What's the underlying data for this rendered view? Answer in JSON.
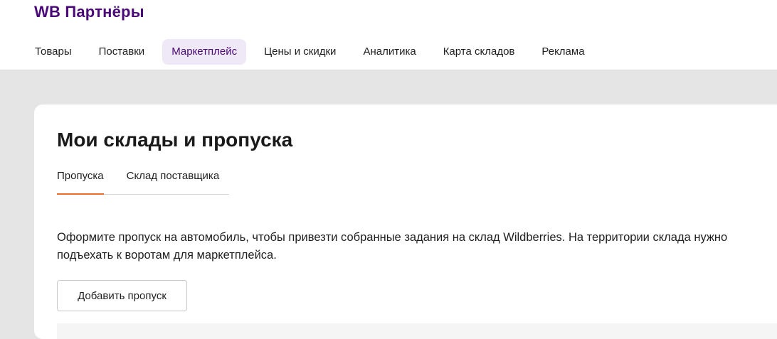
{
  "header": {
    "logo": "WB Партнёры",
    "nav": [
      {
        "label": "Товары",
        "active": false
      },
      {
        "label": "Поставки",
        "active": false
      },
      {
        "label": "Маркетплейс",
        "active": true
      },
      {
        "label": "Цены и скидки",
        "active": false
      },
      {
        "label": "Аналитика",
        "active": false
      },
      {
        "label": "Карта складов",
        "active": false
      },
      {
        "label": "Реклама",
        "active": false
      }
    ]
  },
  "main": {
    "title": "Мои склады и пропуска",
    "tabs": [
      {
        "label": "Пропуска",
        "active": true
      },
      {
        "label": "Склад поставщика",
        "active": false
      }
    ],
    "description": "Оформите пропуск на автомобиль, чтобы привезти собранные задания на склад Wildberries. На территории склада нужно подъехать к воротам для маркетплейса.",
    "add_button_label": "Добавить пропуск"
  },
  "colors": {
    "brand": "#4b0a7a",
    "active_nav_bg": "#efe8f6",
    "tab_underline": "#f06b28",
    "page_bg": "#e5e5e5"
  }
}
